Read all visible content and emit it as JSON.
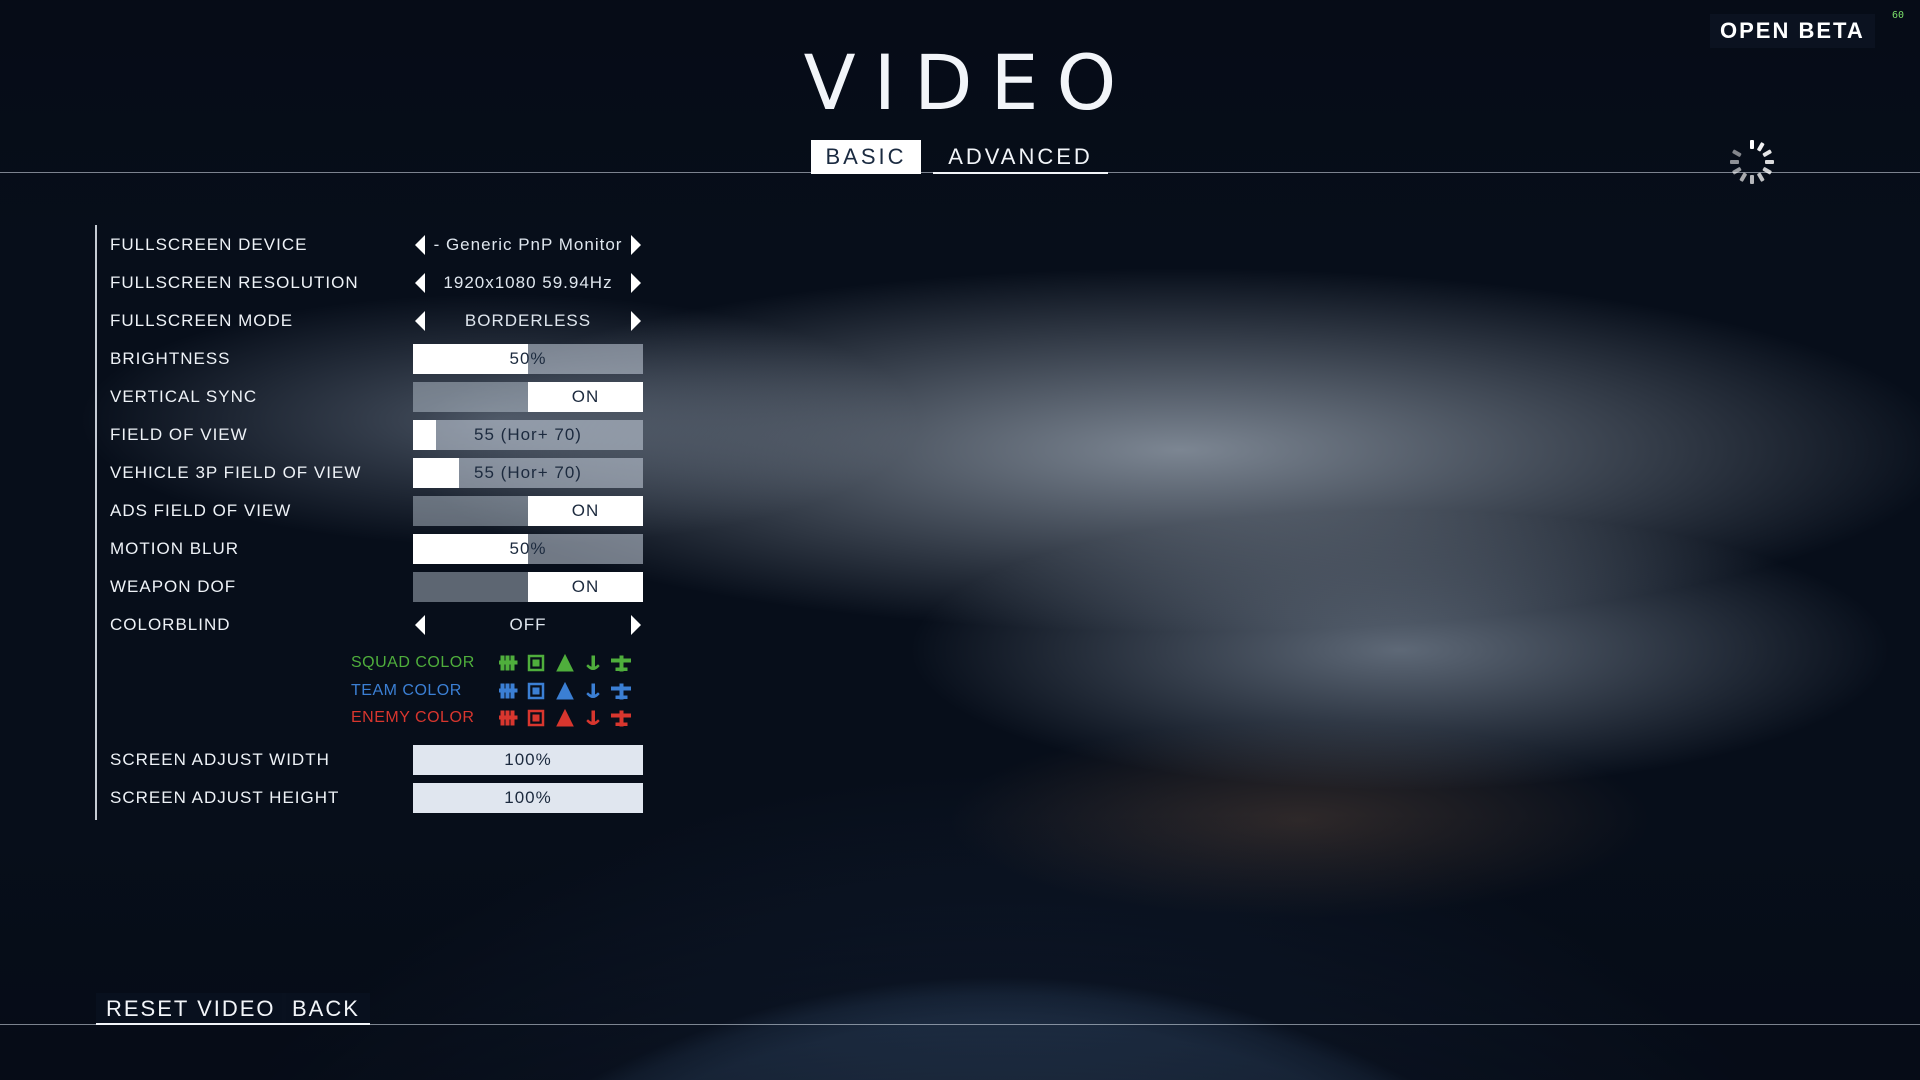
{
  "header": {
    "title": "VIDEO",
    "badge": "OPEN BETA",
    "fps": "60"
  },
  "tabs": [
    {
      "label": "BASIC",
      "active": true
    },
    {
      "label": "ADVANCED",
      "active": false
    }
  ],
  "settings": {
    "fullscreen_device": {
      "label": "FULLSCREEN DEVICE",
      "value": "- Generic PnP Monitor"
    },
    "fullscreen_resolution": {
      "label": "FULLSCREEN RESOLUTION",
      "value": "1920x1080 59.94Hz"
    },
    "fullscreen_mode": {
      "label": "FULLSCREEN MODE",
      "value": "BORDERLESS"
    },
    "brightness": {
      "label": "BRIGHTNESS",
      "value": "50%",
      "fraction": 0.5
    },
    "vertical_sync": {
      "label": "VERTICAL SYNC",
      "value": "ON"
    },
    "field_of_view": {
      "label": "FIELD OF VIEW",
      "value": "55 (Hor+ 70)",
      "fraction": 0.1
    },
    "vehicle_3p_fov": {
      "label": "VEHICLE 3P FIELD OF VIEW",
      "value": "55 (Hor+ 70)",
      "fraction": 0.2
    },
    "ads_fov": {
      "label": "ADS FIELD OF VIEW",
      "value": "ON"
    },
    "motion_blur": {
      "label": "MOTION BLUR",
      "value": "50%",
      "fraction": 0.5
    },
    "weapon_dof": {
      "label": "WEAPON DOF",
      "value": "ON"
    },
    "colorblind": {
      "label": "COLORBLIND",
      "value": "OFF"
    },
    "screen_adjust_width": {
      "label": "SCREEN ADJUST WIDTH",
      "value": "100%",
      "fraction": 1.0
    },
    "screen_adjust_height": {
      "label": "SCREEN ADJUST HEIGHT",
      "value": "100%",
      "fraction": 1.0
    }
  },
  "color_preview": [
    {
      "label": "SQUAD COLOR",
      "color": "#4fae3c"
    },
    {
      "label": "TEAM COLOR",
      "color": "#3b7fd4"
    },
    {
      "label": "ENEMY COLOR",
      "color": "#d8362e"
    }
  ],
  "footer": {
    "reset_label": "RESET VIDEO",
    "back_label": "BACK"
  },
  "icons": [
    "chevron-left-icon",
    "chevron-right-icon",
    "loading-spinner-icon",
    "infantry-icon",
    "squad-icon",
    "vehicle-icon",
    "anchor-icon",
    "plane-icon"
  ]
}
